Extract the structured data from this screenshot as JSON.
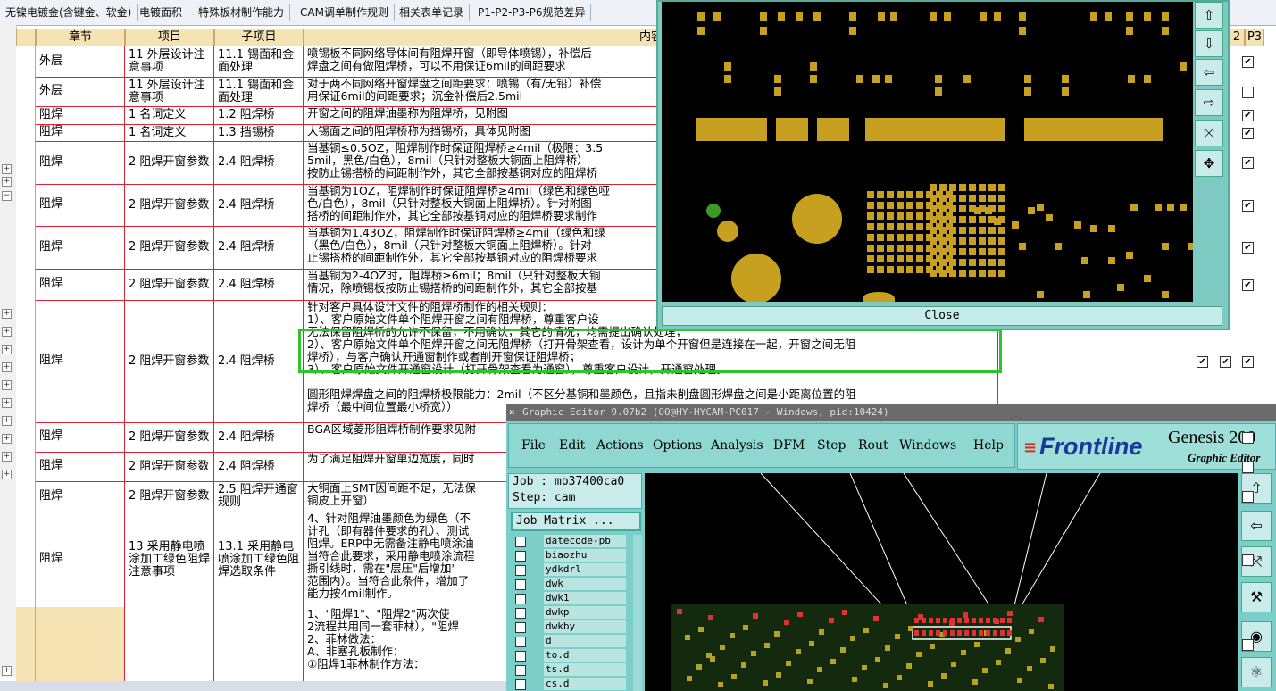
{
  "tabs": [
    "无镍电镀金(含键金、软金)",
    "电镀面积",
    "特殊板材制作能力",
    "CAM调单制作规则",
    "相关表单记录",
    "P1-P2-P3-P6规范差异"
  ],
  "headers": {
    "chapter": "章节",
    "item": "项目",
    "subitem": "子项目",
    "content": "内容",
    "p2": "2",
    "p3": "P3"
  },
  "rows": [
    {
      "chapter": "外层",
      "item": "11 外层设计注意事项",
      "subitem": "11.1 锡面和金面处理",
      "content": [
        "喷锡板不同网络导体间有阻焊开窗（即导体喷锡），补偿后",
        "焊盘之间有做阻焊桥，可以不用保证6mil的间距要求"
      ],
      "p2": false,
      "p3": true
    },
    {
      "chapter": "外层",
      "item": "11 外层设计注意事项",
      "subitem": "11.1 锡面和金面处理",
      "content": [
        "对于两不同网络开窗焊盘之间距要求：喷锡（有/无铅）补偿",
        "用保证6mil的间距要求；沉金补偿后2.5mil"
      ],
      "p2": false,
      "p3": false
    },
    {
      "chapter": "阻焊",
      "item": "1 名词定义",
      "subitem": "1.2 阻焊桥",
      "content": [
        "开窗之间的阻焊油墨称为阻焊桥，见附图"
      ],
      "p2": false,
      "p3": true
    },
    {
      "chapter": "阻焊",
      "item": "1 名词定义",
      "subitem": "1.3 挡锡桥",
      "content": [
        "大锡面之间的阻焊桥称为挡锡桥，具体见附图"
      ],
      "p2": false,
      "p3": true
    },
    {
      "chapter": "阻焊",
      "item": "2 阻焊开窗参数",
      "subitem": "2.4 阻焊桥",
      "content": [
        "当基铜≤0.5OZ，阻焊制作时保证阻焊桥≥4mil（极限：3.5",
        "5mil，黑色/白色），8mil（只针对整板大铜面上阻焊桥）",
        "按防止锡搭桥的间距制作外，其它全部按基铜对应的阻焊桥"
      ],
      "p2": false,
      "p3": true
    },
    {
      "chapter": "阻焊",
      "item": "2 阻焊开窗参数",
      "subitem": "2.4 阻焊桥",
      "content": [
        "当基铜为1OZ，阻焊制作时保证阻焊桥≥4mil（绿色和绿色哑",
        "色/白色），8mil（只针对整板大铜面上阻焊桥）。针对附图",
        "搭桥的间距制作外，其它全部按基铜对应的阻焊桥要求制作"
      ],
      "p2": false,
      "p3": true
    },
    {
      "chapter": "阻焊",
      "item": "2 阻焊开窗参数",
      "subitem": "2.4 阻焊桥",
      "content": [
        "当基铜为1.43OZ，阻焊制作时保证阻焊桥≥4mil（绿色和绿",
        "（黑色/白色），8mil（只针对整板大铜面上阻焊桥）。针对",
        "止锡搭桥的间距制作外，其它全部按基铜对应的阻焊桥要求"
      ],
      "p2": false,
      "p3": true
    },
    {
      "chapter": "阻焊",
      "item": "2 阻焊开窗参数",
      "subitem": "2.4 阻焊桥",
      "content": [
        "当基铜为2-4OZ时，阻焊桥≥6mil；8mil（只针对整板大铜",
        "情况，除喷锡板按防止锡搭桥的间距制作外，其它全部按基"
      ],
      "p2": false,
      "p3": true
    },
    {
      "chapter": "阻焊",
      "item": "2 阻焊开窗参数",
      "subitem": "2.4 阻焊桥",
      "content": [
        "针对客户具体设计文件的阻焊桥制作的相关规则：",
        "1）、客户原始文件单个阻焊开窗之间有阻焊桥，尊重客户设",
        "无法保留阻焊桥的允许不保留，不用确认，其它的情况，均需提出确认处理；",
        "2）、客户原始文件单个阻焊开窗之间无阻焊桥（打开骨架查看，设计为单个开窗但是连接在一起，开窗之间无阻",
        "焊桥），与客户确认开通窗制作或者削开窗保证阻焊桥；",
        "3）、客户原始文件开通窗设计（打开骨架查看为通窗），尊重客户设计，开通窗处理。",
        "",
        "圆形阻焊焊盘之间的阻焊桥极限能力：2mil（不区分基铜和墨颜色，且指未削盘圆形焊盘之间是小距离位置的阻",
        "焊桥（最中间位置最小桥宽））"
      ],
      "p2": true,
      "p3": true
    },
    {
      "chapter": "阻焊",
      "item": "2 阻焊开窗参数",
      "subitem": "2.4 阻焊桥",
      "content": [
        "BGA区域菱形阻焊桥制作要求见附"
      ],
      "p2": false,
      "p3": false
    },
    {
      "chapter": "阻焊",
      "item": "2 阻焊开窗参数",
      "subitem": "2.4 阻焊桥",
      "content": [
        "为了满足阻焊开窗单边宽度，同时"
      ],
      "p2": false,
      "p3": false
    },
    {
      "chapter": "阻焊",
      "item": "2 阻焊开窗参数",
      "subitem": "2.5 阻焊开通窗规则",
      "content": [
        "大铜面上SMT因间距不足，无法保",
        "铜皮上开窗）"
      ],
      "p2": false,
      "p3": false
    },
    {
      "chapter": "阻焊",
      "item": "13 采用静电喷涂加工绿色阻焊注意事项",
      "subitem": "13.1 采用静电喷涂加工绿色阻焊选取条件",
      "content": [
        "4、针对阻焊油墨颜色为绿色（不",
        "计孔（即有器件要求的孔）、测试",
        "阻焊。ERP中无需备注静电喷涂油",
        "当符合此要求，采用静电喷涂流程",
        "撕引线时，需在\"层压\"后增加\"",
        "范围内）。当符合此条件，增加了",
        "能力按4mil制作。"
      ],
      "p2": false,
      "p3": false
    },
    {
      "chapter": "",
      "item": "",
      "subitem": "",
      "content": [
        "1、\"阻焊1\"、\"阻焊2\"两次使",
        "2流程共用同一套菲林），\"阻焊",
        "2、菲林做法：",
        "A、非塞孔板制作：",
        "①阻焊1菲林制作方法："
      ],
      "p2": false,
      "p3": false
    }
  ],
  "dialog": {
    "close_label": "Close",
    "side_icons": [
      "export-icon",
      "import-icon",
      "layer-in-icon",
      "layer-out-icon",
      "fit-icon",
      "center-icon"
    ]
  },
  "editor": {
    "title": "Graphic Editor 9.07b2 (OO@HY-HYCAM-PC017 - Windows, pid:10424)",
    "menu": [
      "File",
      "Edit",
      "Actions",
      "Options",
      "Analysis",
      "DFM",
      "Step",
      "Rout",
      "Windows",
      "Help"
    ],
    "brand": "Frontline",
    "product": "Genesis 200",
    "product_sub": "Graphic Editor",
    "job_label": "Job : mb37400ca0",
    "step_label": "Step: cam",
    "job_matrix": "Job Matrix ...",
    "layers": [
      "datecode-pb",
      "biaozhu",
      "ydkdrl",
      "dwk",
      "dwk1",
      "dwkp",
      "dwkby",
      "d",
      "to.d",
      "ts.d",
      "cs.d"
    ]
  },
  "colors": {
    "grid_line": "#dd2233",
    "header_bg": "#f6e3b4",
    "highlight": "#2ec42e",
    "cad_bg": "#7ccfc8",
    "pad": "#c8a020"
  }
}
